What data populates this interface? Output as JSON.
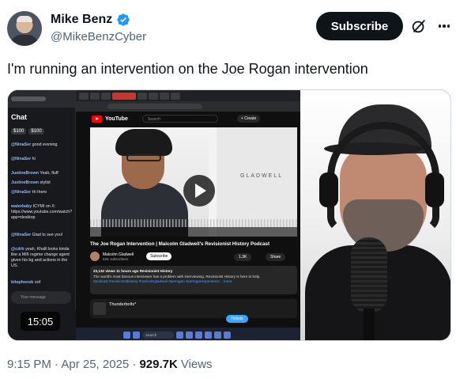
{
  "author": {
    "name": "Mike Benz",
    "handle": "@MikeBenzCyber"
  },
  "actions": {
    "subscribe_label": "Subscribe"
  },
  "tweet": {
    "text": "I'm running an intervention on the Joe Rogan intervention"
  },
  "media": {
    "duration": "15:05",
    "chat": {
      "title": "Chat",
      "pill_1": "$100",
      "pill_2": "$100",
      "messages": [
        {
          "user": "@NinaSer",
          "text": "good evening"
        },
        {
          "user": "@NinaSer",
          "text": "hi"
        },
        {
          "user": "JustineBrown",
          "text": "Yeah, fluff"
        },
        {
          "user": "JustineBrown",
          "text": "stylist"
        },
        {
          "user": "@NinaSer",
          "text": "Hi there"
        },
        {
          "user": "waterbaby",
          "text": "ICYMI on X: https://www.youtube.com/watch?app=desktop"
        },
        {
          "user": "@NinaSer",
          "text": "Glad to see you!"
        },
        {
          "user": "@cdrb",
          "text": "yeah, Khalil looks kinda like a MI6 regime change agent given his bg and actions in the US."
        },
        {
          "user": "bitephonsk",
          "text": "oof"
        }
      ],
      "input_placeholder": "Your message"
    },
    "youtube": {
      "brand": "YouTube",
      "search_placeholder": "Search",
      "create_label": "+ Create",
      "book_title": "GLADWELL",
      "video_title": "The Joe Rogan Intervention | Malcolm Gladwell's Revisionist History Podcast",
      "channel_name": "Malcolm Gladwell",
      "channel_subs": "52K subscribers",
      "subscribe_label": "Subscribe",
      "likes": "1.3K",
      "share_label": "Share",
      "desc_meta": "23,132 views  11 hours ago  Revisionist History",
      "desc_text": "The world's most famous interviewer has a problem with interviewing. Revisionist History is here to help.",
      "desc_tags": "#podcast #revisionisthistory #malcolmgladwell #joerogan #joeroganexperience ...more",
      "next_item": "Thunderbolts*",
      "tickets_label": "Tickets",
      "taskbar_search": "Search"
    }
  },
  "meta": {
    "timestamp": "9:15 PM · Apr 25, 2025 ·",
    "views_count": "929.7K",
    "views_label": "Views"
  }
}
